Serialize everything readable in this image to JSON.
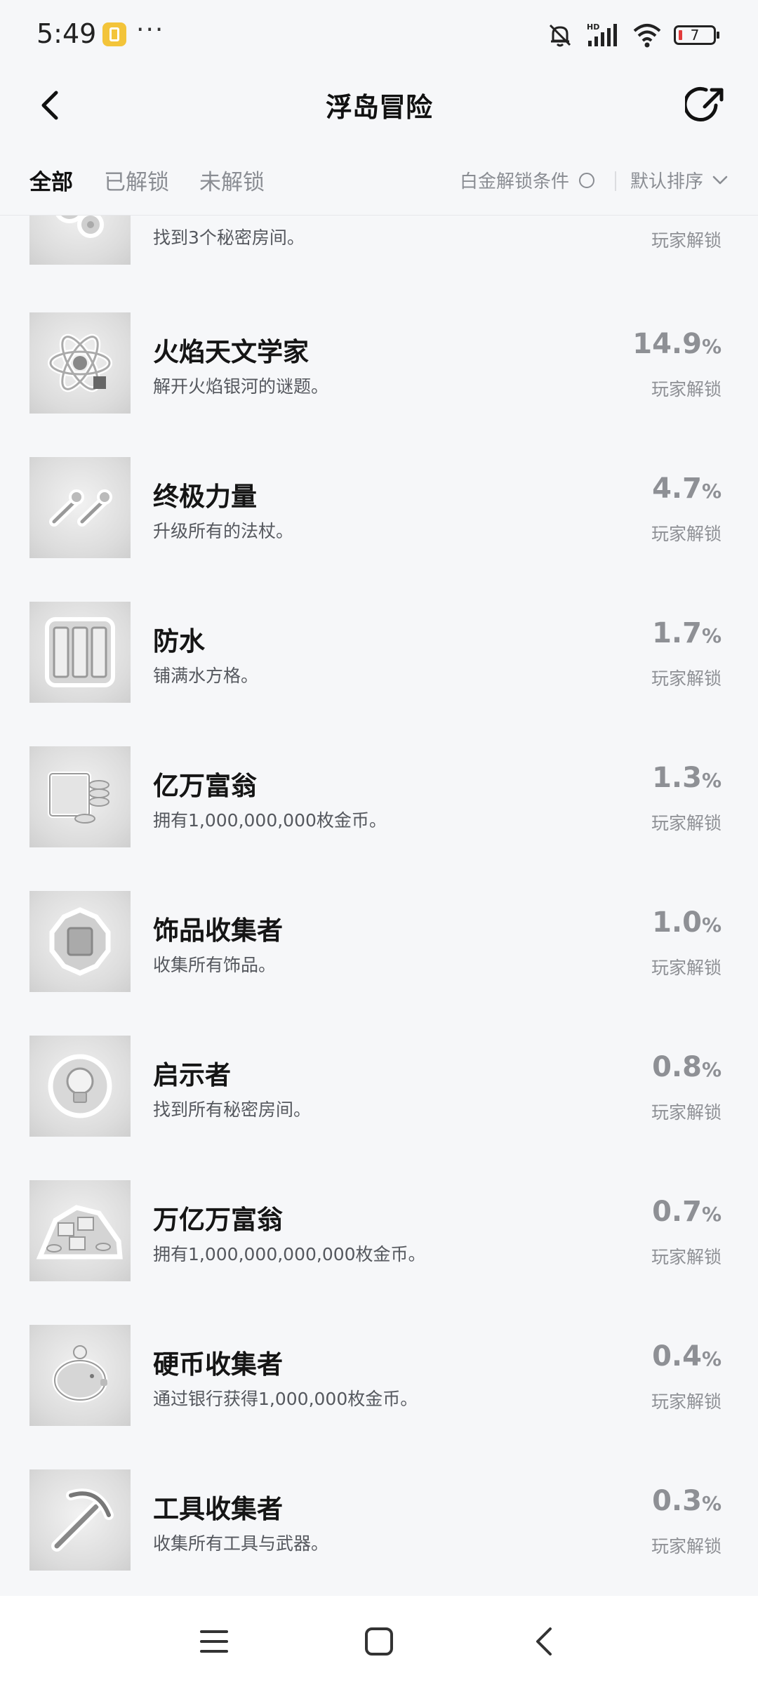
{
  "status_bar": {
    "time": "5:49",
    "more": "···",
    "battery_level": "7",
    "network_label": "HD"
  },
  "header": {
    "title": "浮岛冒险"
  },
  "filters": {
    "tabs": [
      "全部",
      "已解锁",
      "未解锁"
    ],
    "active_tab": "全部",
    "platinum_label": "白金解锁条件",
    "sort_label": "默认排序"
  },
  "achievements": [
    {
      "title": "",
      "desc": "找到3个秘密房间。",
      "pct": "",
      "sub": "玩家解锁",
      "icon": "gears-icon"
    },
    {
      "title": "火焰天文学家",
      "desc": "解开火焰银河的谜题。",
      "pct": "14.9",
      "sub": "玩家解锁",
      "icon": "atom-icon"
    },
    {
      "title": "终极力量",
      "desc": "升级所有的法杖。",
      "pct": "4.7",
      "sub": "玩家解锁",
      "icon": "staves-icon"
    },
    {
      "title": "防水",
      "desc": "铺满水方格。",
      "pct": "1.7",
      "sub": "玩家解锁",
      "icon": "water-tiles-icon"
    },
    {
      "title": "亿万富翁",
      "desc": "拥有1,000,000,000枚金币。",
      "pct": "1.3",
      "sub": "玩家解锁",
      "icon": "coin-stack-icon"
    },
    {
      "title": "饰品收集者",
      "desc": "收集所有饰品。",
      "pct": "1.0",
      "sub": "玩家解锁",
      "icon": "trinket-icon"
    },
    {
      "title": "启示者",
      "desc": "找到所有秘密房间。",
      "pct": "0.8",
      "sub": "玩家解锁",
      "icon": "lightbulb-icon"
    },
    {
      "title": "万亿万富翁",
      "desc": "拥有1,000,000,000,000枚金币。",
      "pct": "0.7",
      "sub": "玩家解锁",
      "icon": "coin-pile-icon"
    },
    {
      "title": "硬币收集者",
      "desc": "通过银行获得1,000,000枚金币。",
      "pct": "0.4",
      "sub": "玩家解锁",
      "icon": "piggy-bank-icon"
    },
    {
      "title": "工具收集者",
      "desc": "收集所有工具与武器。",
      "pct": "0.3",
      "sub": "玩家解锁",
      "icon": "pickaxe-icon"
    }
  ],
  "pct_sign": "%",
  "colors": {
    "background": "#f6f7f9",
    "muted_text": "#8e9095",
    "title_text": "#151515",
    "battery_low": "#e23b3b"
  }
}
